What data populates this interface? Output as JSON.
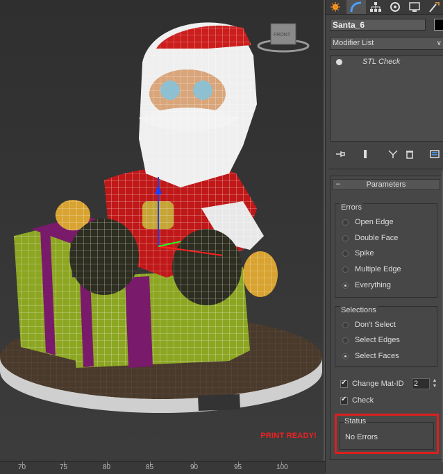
{
  "viewport": {
    "overlay_text": "PRINT READY!"
  },
  "ruler": {
    "ticks": [
      "70",
      "75",
      "80",
      "85",
      "90",
      "95",
      "100"
    ]
  },
  "command_panel": {
    "tabs": [
      "create-icon",
      "modify-icon",
      "hierarchy-icon",
      "motion-icon",
      "display-icon",
      "utilities-icon"
    ],
    "object_name": "Santa_6",
    "object_color": "#000000",
    "modifier_list": "Modifier List",
    "stack": {
      "items": [
        "STL Check"
      ]
    },
    "rollout": {
      "title": "Parameters",
      "errors": {
        "title": "Errors",
        "options": [
          "Open Edge",
          "Double Face",
          "Spike",
          "Multiple Edge",
          "Everything"
        ],
        "selected": "Everything"
      },
      "selections": {
        "title": "Selections",
        "options": [
          "Don't Select",
          "Select Edges",
          "Select Faces"
        ],
        "selected": "Select Faces"
      },
      "change_mat_id": {
        "label": "Change Mat-ID",
        "checked": true,
        "value": "2"
      },
      "check": {
        "label": "Check",
        "checked": true
      },
      "status": {
        "title": "Status",
        "text": "No Errors"
      }
    }
  },
  "colors": {
    "highlight_box": "#dd1f1f",
    "overlay_text": "#ee2222"
  }
}
